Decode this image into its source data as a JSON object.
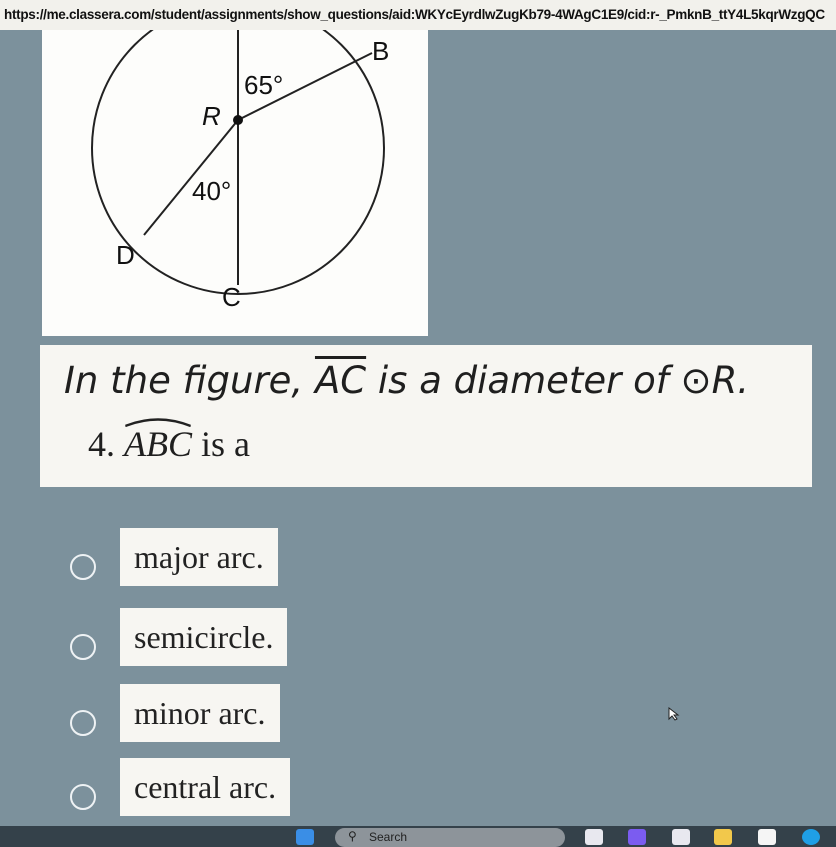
{
  "address_bar": {
    "url": "https://me.classera.com/student/assignments/show_questions/aid:WKYcEyrdlwZugKb79-4WAgC1E9/cid:r-_PmknB_ttY4L5kqrWzgQC"
  },
  "figure": {
    "labels": {
      "B": "B",
      "R": "R",
      "D": "D",
      "C": "C",
      "angle_br": "65°",
      "angle_dr": "40°"
    }
  },
  "question": {
    "statement_prefix": "In the figure,",
    "statement_diameter": "AC",
    "statement_middle": "is a diameter of",
    "statement_circle_symbol": "⊙",
    "statement_circle": "R.",
    "number": "4.",
    "arc_name": "ABC",
    "stem_suffix": "is a"
  },
  "options": [
    {
      "label": "major arc."
    },
    {
      "label": "semicircle."
    },
    {
      "label": "minor arc."
    },
    {
      "label": "central arc."
    }
  ],
  "taskbar": {
    "search_label": "Search",
    "colors": {
      "start": "#3a8ee6",
      "widgets": "#e8e8ef",
      "copilot": "#7b5cf0",
      "folder": "#f2c84b",
      "store": "#f5f5f5",
      "edge": "#1f9fe6"
    }
  }
}
